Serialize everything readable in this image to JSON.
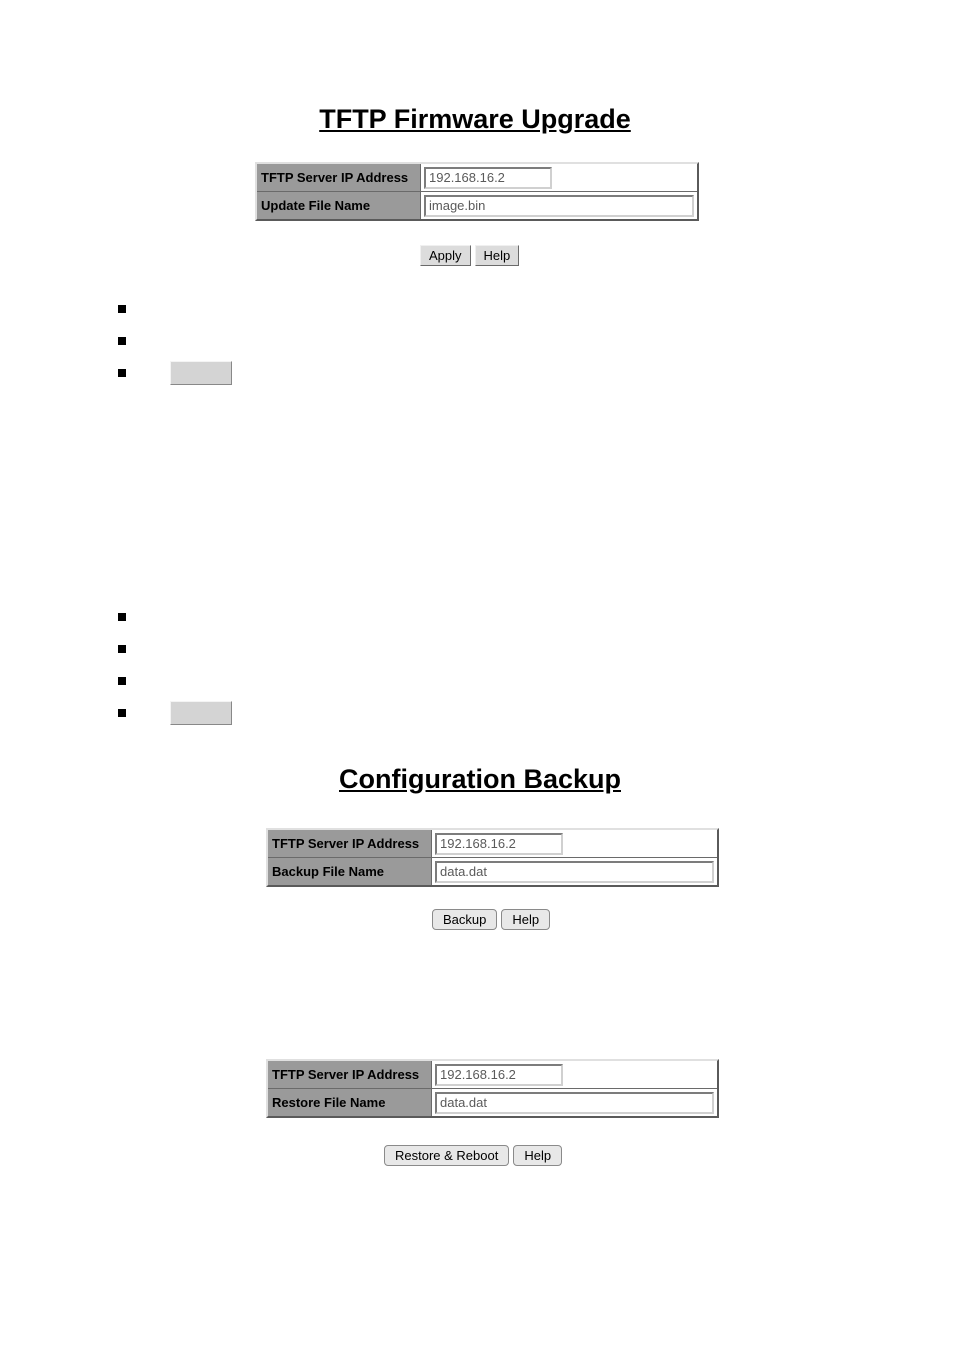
{
  "firmware": {
    "title": "TFTP Firmware Upgrade",
    "ip_label": "TFTP Server IP Address",
    "ip_value": "192.168.16.2",
    "file_label": "Update File Name",
    "file_value": "image.bin",
    "apply_label": "Apply",
    "help_label": "Help"
  },
  "config": {
    "title": "Configuration Backup"
  },
  "backup": {
    "ip_label": "TFTP Server IP Address",
    "ip_value": "192.168.16.2",
    "file_label": "Backup File Name",
    "file_value": "data.dat",
    "backup_label": "Backup",
    "help_label": "Help"
  },
  "restore": {
    "ip_label": "TFTP Server IP Address",
    "ip_value": "192.168.16.2",
    "file_label": "Restore File Name",
    "file_value": "data.dat",
    "restore_label": "Restore & Reboot",
    "help_label": "Help"
  }
}
